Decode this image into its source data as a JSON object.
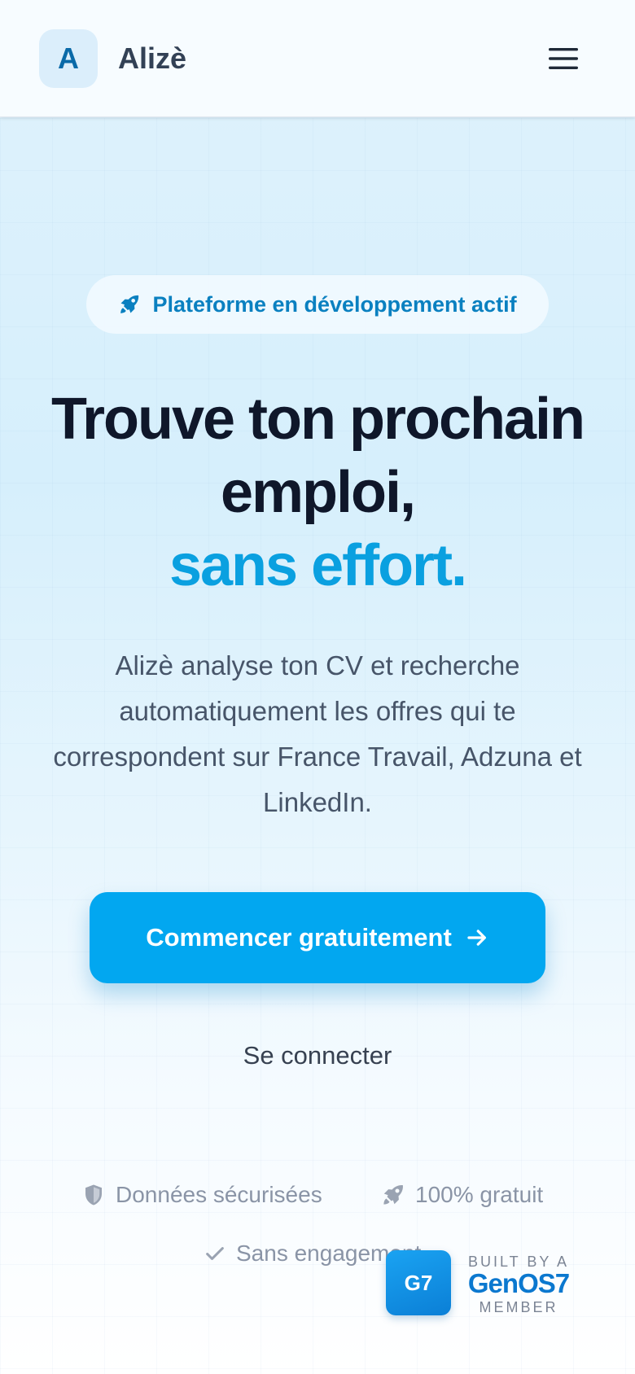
{
  "header": {
    "logo_letter": "A",
    "brand_name": "Alizè",
    "menu_icon": "hamburger-menu-icon"
  },
  "badge": {
    "icon": "rocket-icon",
    "label": "Plateforme en développement actif"
  },
  "hero": {
    "headline_line1": "Trouve ton prochain",
    "headline_line2": "emploi,",
    "headline_accent": "sans effort.",
    "description": "Alizè analyse ton CV et recherche automatiquement les offres qui te correspondent sur France Travail, Adzuna et LinkedIn."
  },
  "actions": {
    "primary_label": "Commencer gratuitement",
    "primary_icon": "arrow-right-icon",
    "secondary_label": "Se connecter"
  },
  "trust": [
    {
      "icon": "shield-icon",
      "label": "Données sécurisées"
    },
    {
      "icon": "rocket-icon",
      "label": "100% gratuit"
    },
    {
      "icon": "check-icon",
      "label": "Sans engagement"
    }
  ],
  "built_badge": {
    "logo_text": "G7",
    "top_text": "BUILT BY A",
    "name": "GenOS7",
    "bottom_text": "MEMBER"
  },
  "colors": {
    "accent": "#0aa0e0",
    "cta": "#02a7f0",
    "heading": "#0f172a",
    "body_text": "#475569"
  }
}
